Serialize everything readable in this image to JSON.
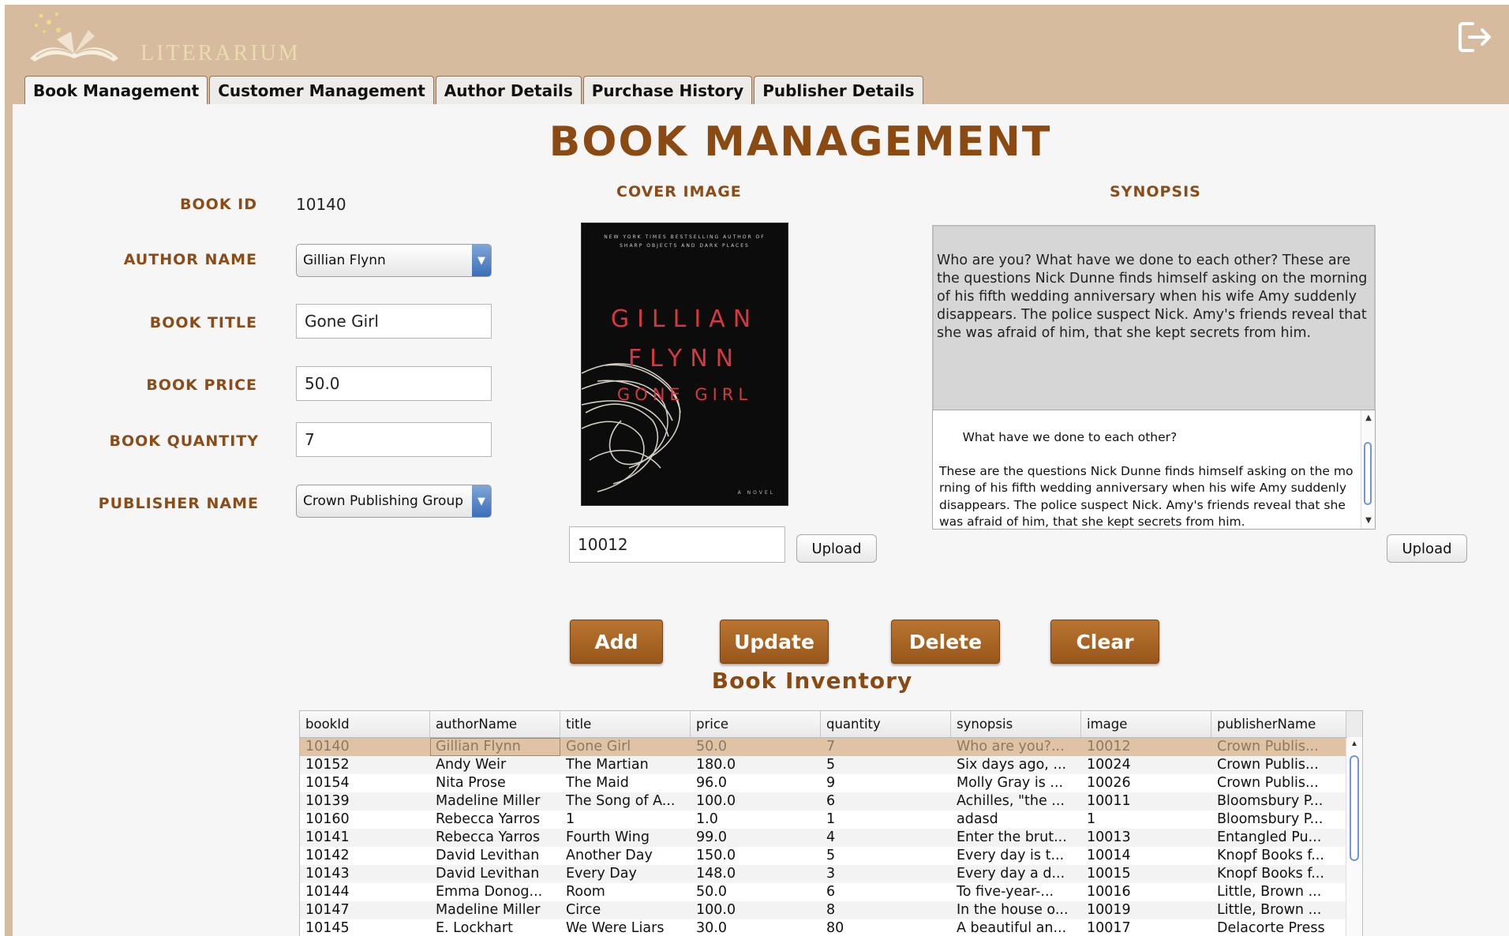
{
  "app": {
    "name": "LITERARIUM"
  },
  "tabs": [
    {
      "label": "Book Management",
      "active": true
    },
    {
      "label": "Customer Management",
      "active": false
    },
    {
      "label": "Author Details",
      "active": false
    },
    {
      "label": "Purchase History",
      "active": false
    },
    {
      "label": "Publisher Details",
      "active": false
    }
  ],
  "page": {
    "title": "BOOK MANAGEMENT"
  },
  "form": {
    "book_id_label": "BOOK ID",
    "book_id_value": "10140",
    "author_name_label": "AUTHOR NAME",
    "author_name_value": "Gillian Flynn",
    "book_title_label": "BOOK TITLE",
    "book_title_value": "Gone Girl",
    "book_price_label": "BOOK PRICE",
    "book_price_value": "50.0",
    "book_quantity_label": "BOOK QUANTITY",
    "book_quantity_value": "7",
    "publisher_name_label": "PUBLISHER NAME",
    "publisher_name_value": "Crown Publishing Group"
  },
  "cover": {
    "label": "COVER IMAGE",
    "top_line_1": "NEW YORK TIMES BESTSELLING AUTHOR OF",
    "top_line_2": "SHARP OBJECTS AND DARK PLACES",
    "author_first": "GILLIAN",
    "author_last": "FLYNN",
    "title": "GONE GIRL",
    "tagline": "A NOVEL",
    "image_id": "10012",
    "upload_label": "Upload"
  },
  "synopsis": {
    "label": "SYNOPSIS",
    "display_text": "Who are you? What have we done to each other? These are the questions Nick Dunne finds himself asking on the morning of his fifth wedding anniversary when his wife Amy suddenly disappears. The police suspect Nick. Amy's friends reveal that she was afraid of him, that she kept secrets from him.",
    "edit_text": "What have we done to each other?\n\nThese are the questions Nick Dunne finds himself asking on the morning of his fifth wedding anniversary when his wife Amy suddenly disappears. The police suspect Nick. Amy's friends reveal that she was afraid of him, that she kept secrets from him.",
    "upload_label": "Upload"
  },
  "actions": {
    "add": "Add",
    "update": "Update",
    "delete": "Delete",
    "clear": "Clear"
  },
  "inventory": {
    "title": "Book Inventory",
    "columns": [
      "bookId",
      "authorName",
      "title",
      "price",
      "quantity",
      "synopsis",
      "image",
      "publisherName"
    ],
    "rows": [
      [
        "10140",
        "Gillian Flynn",
        "Gone Girl",
        "50.0",
        "7",
        "Who are you?...",
        "10012",
        "Crown Publis..."
      ],
      [
        "10152",
        "Andy Weir",
        "The Martian",
        "180.0",
        "5",
        "Six days ago, ...",
        "10024",
        "Crown Publis..."
      ],
      [
        "10154",
        "Nita Prose",
        "The Maid",
        "96.0",
        "9",
        "Molly Gray is ...",
        "10026",
        "Crown Publis..."
      ],
      [
        "10139",
        "Madeline Miller",
        "The Song of A...",
        "100.0",
        "6",
        "Achilles, \"the ...",
        "10011",
        "Bloomsbury P..."
      ],
      [
        "10160",
        "Rebecca Yarros",
        "1",
        "1.0",
        "1",
        "adasd",
        "1",
        "Bloomsbury P..."
      ],
      [
        "10141",
        "Rebecca Yarros",
        "Fourth Wing",
        "99.0",
        "4",
        "Enter the brut...",
        "10013",
        "Entangled Pu..."
      ],
      [
        "10142",
        "David Levithan",
        "Another Day",
        "150.0",
        "5",
        "Every day is t...",
        "10014",
        "Knopf Books f..."
      ],
      [
        "10143",
        "David Levithan",
        "Every Day",
        "148.0",
        "3",
        "Every day a d...",
        "10015",
        "Knopf Books f..."
      ],
      [
        "10144",
        "Emma Donog...",
        "Room",
        "50.0",
        "6",
        "To five-year-...",
        "10016",
        "Little, Brown ..."
      ],
      [
        "10147",
        "Madeline Miller",
        "Circe",
        "100.0",
        "8",
        "In the house o...",
        "10019",
        "Little, Brown ..."
      ],
      [
        "10145",
        "E. Lockhart",
        "We Were Liars",
        "30.0",
        "80",
        "A beautiful an...",
        "10017",
        "Delacorte Press"
      ]
    ],
    "selected_row": 0
  },
  "colors": {
    "header_bg": "#d7bb9e",
    "accent_brown": "#8b4a12",
    "button_brown": "#a8662a",
    "selected_row": "#dfc3a2"
  },
  "icons": {
    "logo": "open-book-logo-icon",
    "logout": "logout-icon",
    "dropdown": "chevron-down-icon"
  }
}
